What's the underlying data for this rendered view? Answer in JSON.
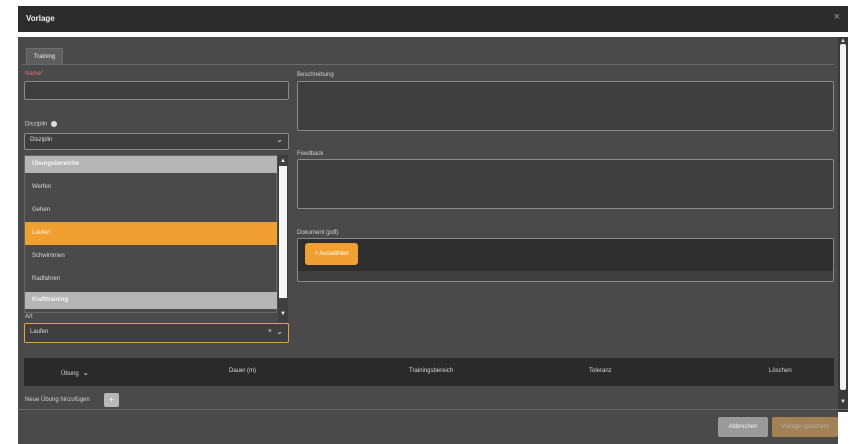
{
  "window": {
    "title": "Vorlage",
    "close": "×"
  },
  "tabs": [
    {
      "label": "Training"
    }
  ],
  "form": {
    "name_label": "Name*",
    "name_value": "",
    "description_label": "Beschreibung",
    "feedback_label": "Feedback",
    "discipline_label": "Disziplin",
    "discipline_value": "Disziplin",
    "document_label": "Dokument (pdf)",
    "select_button": "+ Auswählen",
    "art_label": "Art",
    "art_value": "Laufen"
  },
  "dropdown": {
    "items": [
      {
        "type": "group",
        "label": "Übungsbereiche"
      },
      {
        "type": "option",
        "label": "Werfen"
      },
      {
        "type": "option",
        "label": "Gehen"
      },
      {
        "type": "option",
        "label": "Laufen",
        "selected": true
      },
      {
        "type": "option",
        "label": "Schwimmen"
      },
      {
        "type": "option",
        "label": "Radfahren"
      },
      {
        "type": "group",
        "label": "Krafttraining"
      }
    ]
  },
  "table": {
    "headers": [
      "Übung",
      "Dauer (m)",
      "Trainingsbereich",
      "Toleranz",
      "Löschen"
    ]
  },
  "add_exercise_label": "Neue Übung hinzufügen",
  "footer": {
    "cancel": "Abbrechen",
    "save": "Vorlage speichern"
  },
  "colors": {
    "accent": "#f0a030",
    "panel": "#4a4a4a",
    "titlebar": "#2c2c2c"
  }
}
